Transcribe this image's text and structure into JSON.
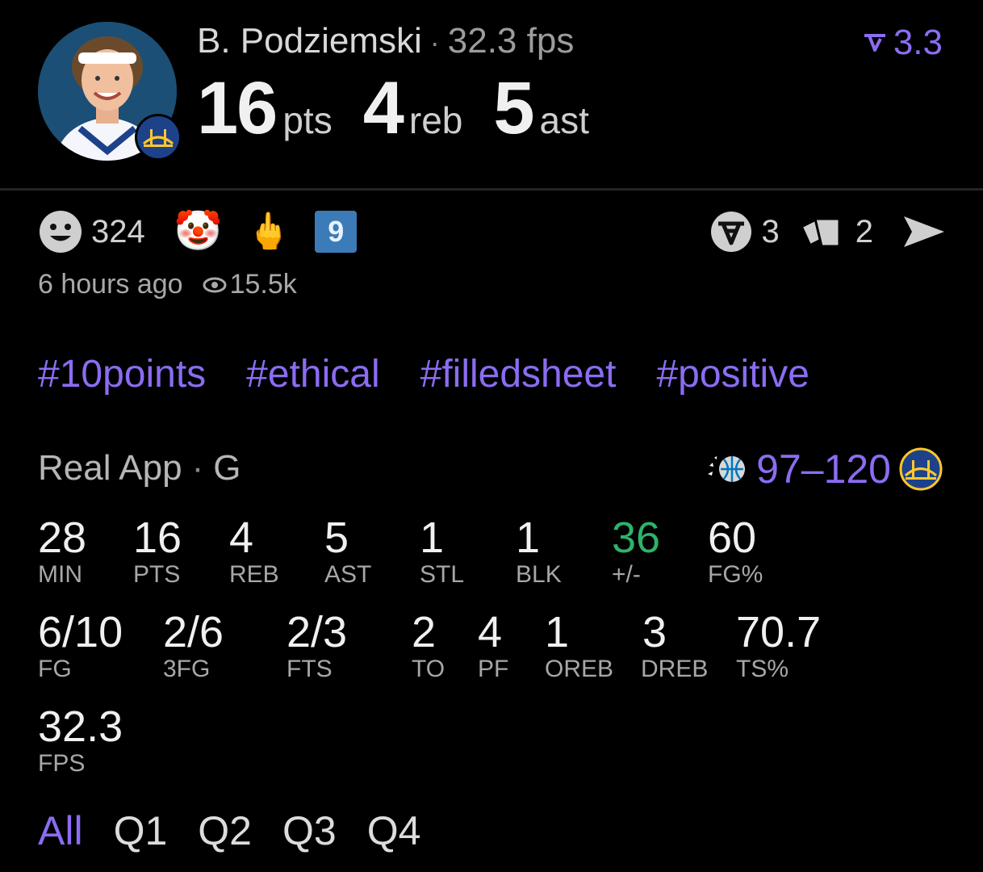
{
  "player": {
    "name": "B. Podziemski",
    "separator": "·",
    "fps_text": "32.3 fps",
    "team_logo": "warriors-bridge-logo"
  },
  "headline": {
    "pts": "16",
    "pts_unit": "pts",
    "reb": "4",
    "reb_unit": "reb",
    "ast": "5",
    "ast_unit": "ast"
  },
  "rating": {
    "value": "3.3",
    "icon": "rating-chevron-icon"
  },
  "reactions": {
    "smiley_count": "324",
    "clown": "🤡",
    "middle_finger": "🖕",
    "number_badge": "9"
  },
  "actions": {
    "vote_count": "3",
    "cards_count": "2"
  },
  "meta": {
    "time_ago": "6 hours ago",
    "views": "15.5k"
  },
  "tags": [
    "#10points",
    "#ethical",
    "#filledsheet",
    "#positive"
  ],
  "game": {
    "source": "Real App",
    "separator": "·",
    "position": "G",
    "score": "97–120"
  },
  "stats_row1": [
    {
      "value": "28",
      "label": "MIN"
    },
    {
      "value": "16",
      "label": "PTS"
    },
    {
      "value": "4",
      "label": "REB"
    },
    {
      "value": "5",
      "label": "AST"
    },
    {
      "value": "1",
      "label": "STL"
    },
    {
      "value": "1",
      "label": "BLK"
    },
    {
      "value": "36",
      "label": "+/-"
    },
    {
      "value": "60",
      "label": "FG%"
    }
  ],
  "stats_row2": [
    {
      "value": "6/10",
      "label": "FG"
    },
    {
      "value": "2/6",
      "label": "3FG"
    },
    {
      "value": "2/3",
      "label": "FTS"
    },
    {
      "value": "2",
      "label": "TO"
    },
    {
      "value": "4",
      "label": "PF"
    },
    {
      "value": "1",
      "label": "OREB"
    },
    {
      "value": "3",
      "label": "DREB"
    },
    {
      "value": "70.7",
      "label": "TS%"
    }
  ],
  "stats_row3": [
    {
      "value": "32.3",
      "label": "FPS"
    }
  ],
  "quarters": [
    "All",
    "Q1",
    "Q2",
    "Q3",
    "Q4"
  ],
  "colors": {
    "accent": "#8b6cf2",
    "positive": "#2db36a",
    "background": "#000000"
  }
}
